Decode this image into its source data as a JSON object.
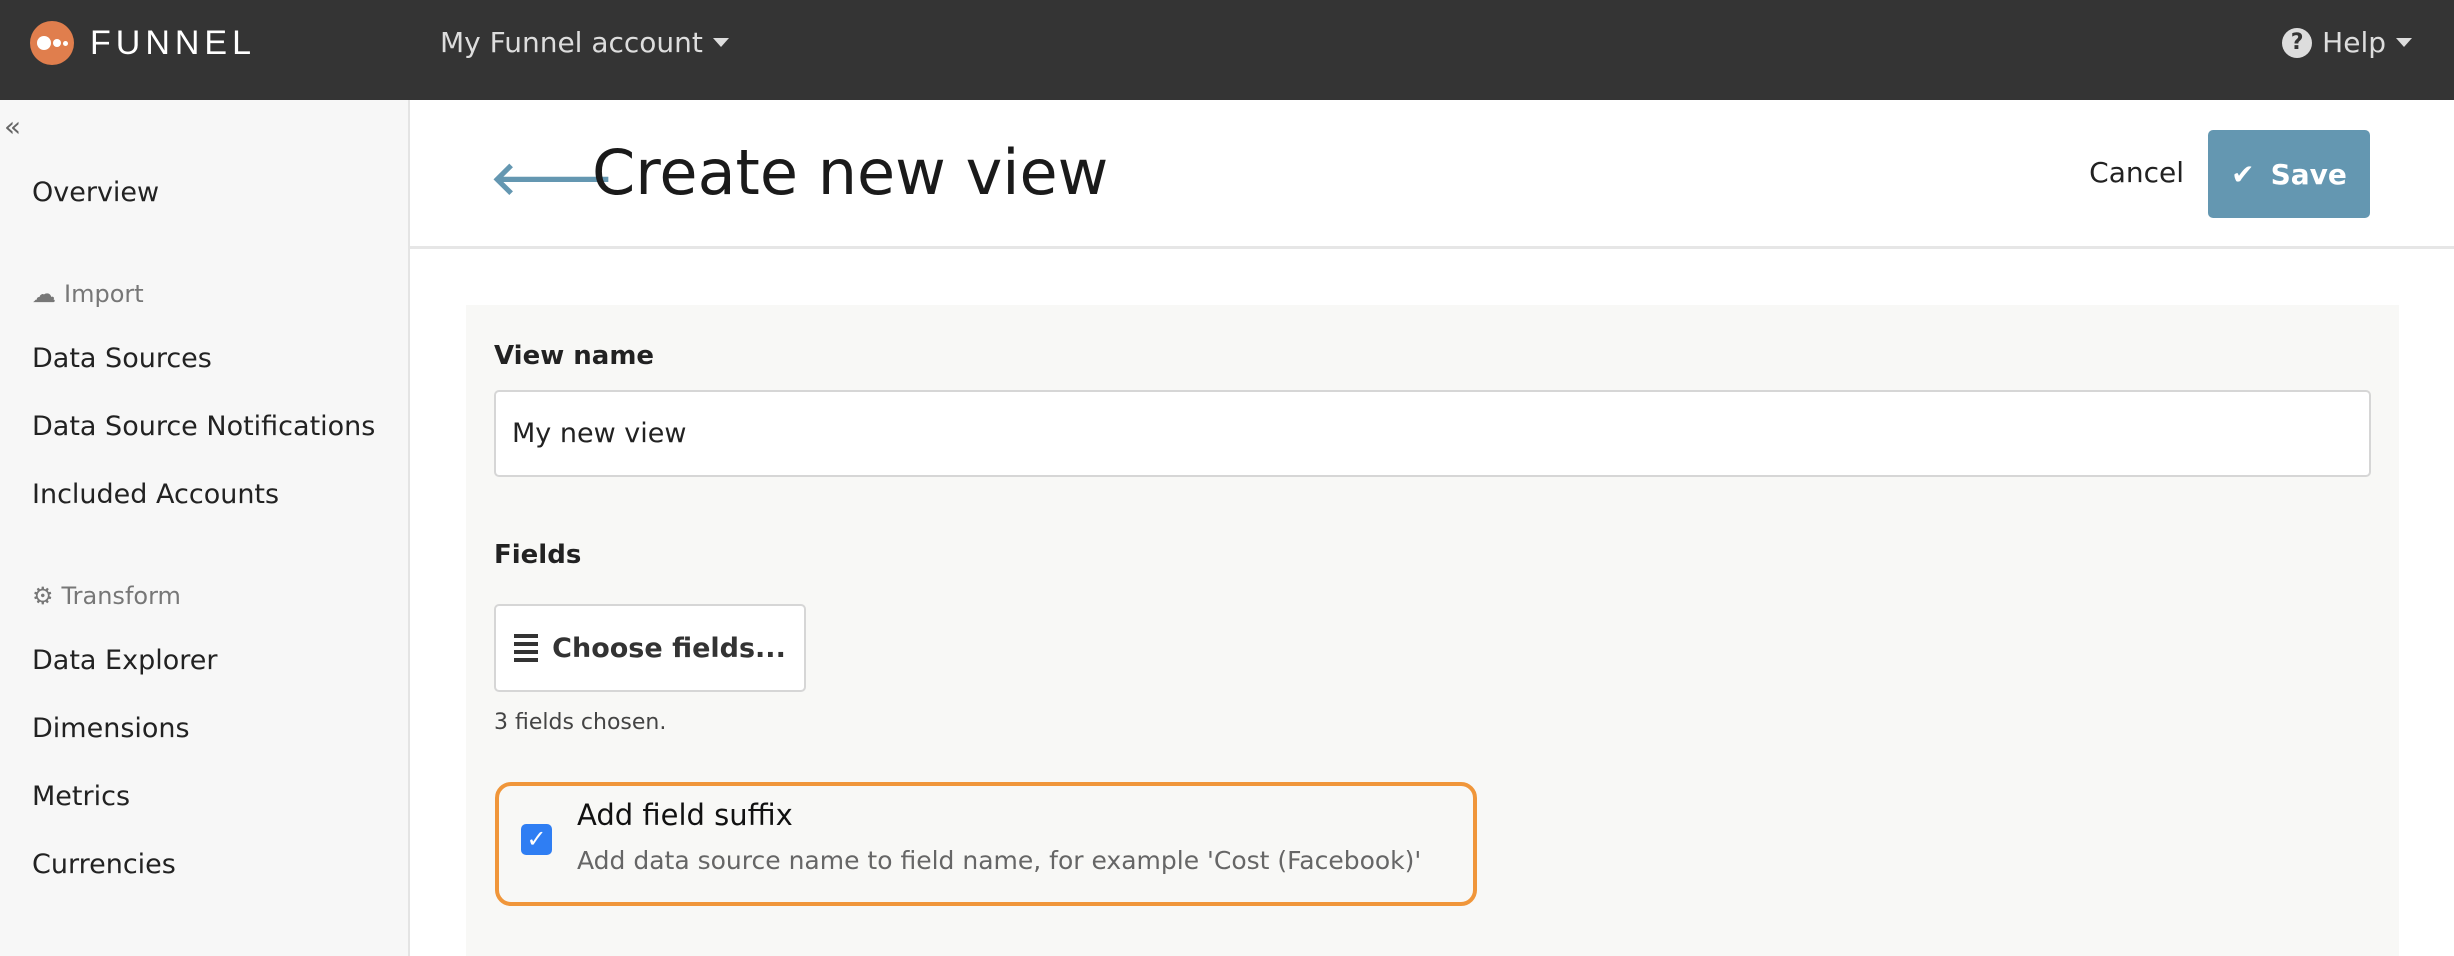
{
  "header": {
    "logo_text": "FUNNEL",
    "account": "My Funnel account",
    "help": "Help"
  },
  "sidebar": {
    "overview": "Overview",
    "import_heading": "Import",
    "import_items": [
      "Data Sources",
      "Data Source Notifications",
      "Included Accounts"
    ],
    "transform_heading": "Transform",
    "transform_items": [
      "Data Explorer",
      "Dimensions",
      "Metrics",
      "Currencies"
    ]
  },
  "page": {
    "title": "Create new view",
    "cancel": "Cancel",
    "save": "Save"
  },
  "form": {
    "view_name_label": "View name",
    "view_name_value": "My new view",
    "fields_label": "Fields",
    "choose_fields": "Choose fields...",
    "fields_chosen": "3 fields chosen.",
    "suffix_checked": true,
    "suffix_title": "Add field suffix",
    "suffix_desc": "Add data source name to field name, for example 'Cost (Facebook)'"
  },
  "colors": {
    "topbar": "#343434",
    "accent": "#6497b1",
    "logo": "#e07e4d",
    "highlight": "#f0963a",
    "checkbox": "#2f7ef3"
  }
}
